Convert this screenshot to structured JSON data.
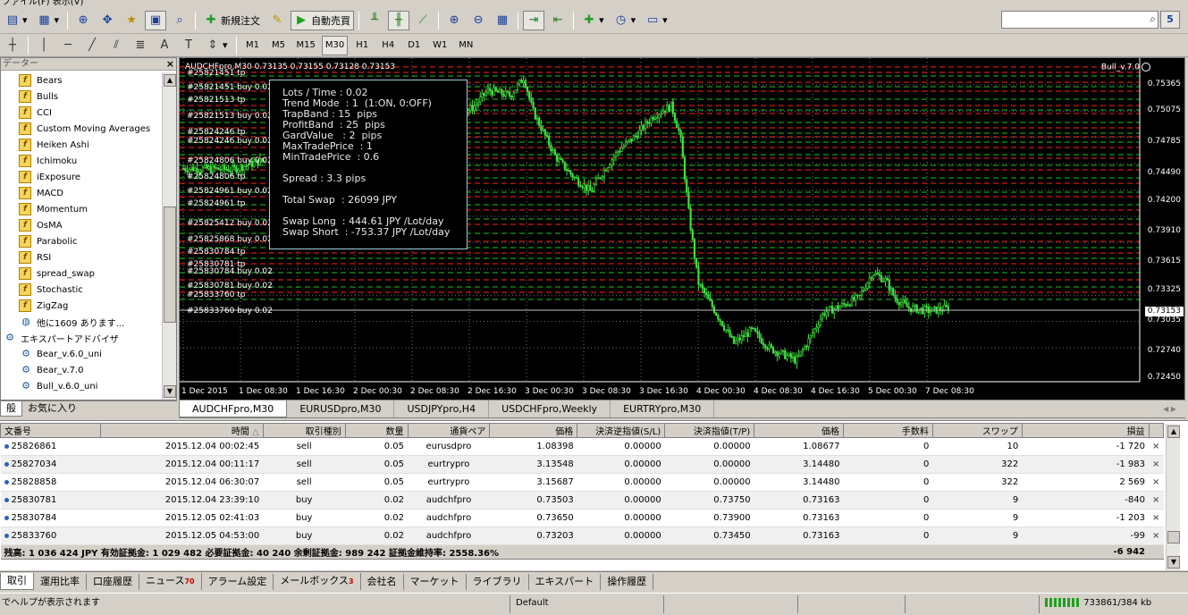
{
  "menubar": {
    "text": "ファイル(F)   表示(V)"
  },
  "toolbar": {
    "new_order": "新規注文",
    "auto_trade": "自動売買",
    "badge": "5",
    "timeframes": [
      "M1",
      "M5",
      "M15",
      "M30",
      "H1",
      "H4",
      "D1",
      "W1",
      "MN"
    ],
    "active_timeframe": "M30",
    "text_tool": "A"
  },
  "navigator": {
    "title": "データー",
    "close": "×",
    "indicators": [
      "Bears",
      "Bulls",
      "CCI",
      "Custom Moving Averages",
      "Heiken Ashi",
      "Ichimoku",
      "iExposure",
      "MACD",
      "Momentum",
      "OsMA",
      "Parabolic",
      "RSI",
      "spread_swap",
      "Stochastic",
      "ZigZag"
    ],
    "more": "他に1609 あります...",
    "ea_group": "エキスパートアドバイザ",
    "experts": [
      "Bear_v.6.0_uni",
      "Bear_v.7.0",
      "Bull_v.6.0_uni"
    ],
    "tabs": [
      "般",
      "お気に入り"
    ]
  },
  "chart": {
    "header": "AUDCHFpro,M30  0.73135 0.73155 0.73128 0.73153",
    "ea_name": "Bull_v.7.0",
    "current_price": "0.73153",
    "price_labels": [
      "0.75365",
      "0.75075",
      "0.74785",
      "0.74490",
      "0.74200",
      "0.73910",
      "0.73615",
      "0.73325",
      "0.73035",
      "0.72740",
      "0.72450"
    ],
    "time_labels": [
      "1 Dec 2015",
      "1 Dec 08:30",
      "1 Dec 16:30",
      "2 Dec 00:30",
      "2 Dec 08:30",
      "2 Dec 16:30",
      "3 Dec 00:30",
      "3 Dec 08:30",
      "3 Dec 16:30",
      "4 Dec 00:30",
      "4 Dec 08:30",
      "4 Dec 16:30",
      "5 Dec 00:30",
      "7 Dec 08:30"
    ],
    "order_labels": [
      "#25821451 tp",
      "#25821451 buy 0.02",
      "#25821513 tp",
      "#25821513 buy 0.02",
      "#25824246 tp",
      "#25824246 buy 0.02",
      "#25824806 buy 0.02",
      "#25824806 tp",
      "#25824961 buy 0.02",
      "#25824961 tp",
      "#25825412 buy 0.02",
      "#25825868 buy 0.02",
      "#25830784 tp",
      "#25830781 tp",
      "#25830784 buy 0.02",
      "#25830781 buy 0.02",
      "#25833760 tp",
      "#25833760 buy 0.02"
    ],
    "info_panel": {
      "lots": "Lots / Time : 0.02",
      "trend_mode": "Trend Mode  : 1  (1:ON, 0:OFF)",
      "trap_band": "TrapBand : 15  pips",
      "profit_band": "ProfitBand  : 25  pips",
      "gard_value": "GardValue   : 2  pips",
      "max_trade_price": "MaxTradePrice  : 1",
      "min_trade_price": "MinTradePrice  : 0.6",
      "spread": "Spread : 3.3 pips",
      "total_swap": "Total Swap  : 26099 JPY",
      "swap_long": "Swap Long  : 444.61 JPY /Lot/day",
      "swap_short": "Swap Short  : -753.37 JPY /Lot/day"
    }
  },
  "chart_tabs": [
    "AUDCHFpro,M30",
    "EURUSDpro,M30",
    "USDJPYpro,H4",
    "USDCHFpro,Weekly",
    "EURTRYpro,M30"
  ],
  "terminal": {
    "columns": [
      "文番号",
      "時間",
      "取引種別",
      "数量",
      "通貨ペア",
      "価格",
      "決済逆指値(S/L)",
      "決済指値(T/P)",
      "価格",
      "手数料",
      "スワップ",
      "損益"
    ],
    "rows": [
      [
        "25826861",
        "2015.12.04 00:02:45",
        "sell",
        "0.05",
        "eurusdpro",
        "1.08398",
        "0.00000",
        "0.00000",
        "1.08677",
        "0",
        "10",
        "-1 720"
      ],
      [
        "25827034",
        "2015.12.04 00:11:17",
        "sell",
        "0.05",
        "eurtrypro",
        "3.13548",
        "0.00000",
        "0.00000",
        "3.14480",
        "0",
        "322",
        "-1 983"
      ],
      [
        "25828858",
        "2015.12.04 06:30:07",
        "sell",
        "0.05",
        "eurtrypro",
        "3.15687",
        "0.00000",
        "0.00000",
        "3.14480",
        "0",
        "322",
        "2 569"
      ],
      [
        "25830781",
        "2015.12.04 23:39:10",
        "buy",
        "0.02",
        "audchfpro",
        "0.73503",
        "0.00000",
        "0.73750",
        "0.73163",
        "0",
        "9",
        "-840"
      ],
      [
        "25830784",
        "2015.12.05 02:41:03",
        "buy",
        "0.02",
        "audchfpro",
        "0.73650",
        "0.00000",
        "0.73900",
        "0.73163",
        "0",
        "9",
        "-1 203"
      ],
      [
        "25833760",
        "2015.12.05 04:53:00",
        "buy",
        "0.02",
        "audchfpro",
        "0.73203",
        "0.00000",
        "0.73450",
        "0.73163",
        "0",
        "9",
        "-99"
      ]
    ],
    "summary": "残高: 1 036 424 JPY  有効証拠金: 1 029 482  必要証拠金: 40 240  余剰証拠金: 989 242  証拠金維持率: 2558.36%",
    "summary_total": "-6 942",
    "close_icon": "×"
  },
  "bottom_tabs": [
    {
      "label": "取引",
      "count": ""
    },
    {
      "label": "運用比率",
      "count": ""
    },
    {
      "label": "口座履歴",
      "count": ""
    },
    {
      "label": "ニュース",
      "count": "70"
    },
    {
      "label": "アラーム設定",
      "count": ""
    },
    {
      "label": "メールボックス",
      "count": "3"
    },
    {
      "label": "会社名",
      "count": ""
    },
    {
      "label": "マーケット",
      "count": ""
    },
    {
      "label": "ライブラリ",
      "count": ""
    },
    {
      "label": "エキスパート",
      "count": ""
    },
    {
      "label": "操作履歴",
      "count": ""
    }
  ],
  "status": {
    "help": "でヘルプが表示されます",
    "profile": "Default",
    "traffic": "733861/384 kb"
  },
  "colors": {
    "candle": "#40e040",
    "sl_line": "#ff2020",
    "tp_line": "#20c020",
    "grid": "#c0c0c0"
  }
}
